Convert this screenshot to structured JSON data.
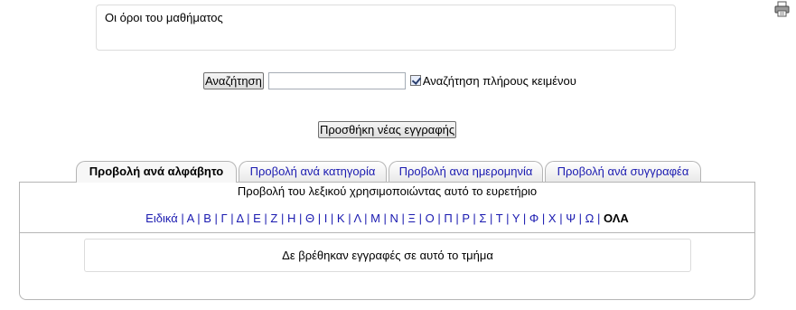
{
  "description": {
    "text": "Οι όροι του μαθήματος"
  },
  "search": {
    "button_label": "Αναζήτηση",
    "input_value": "",
    "fulltext_label": "Αναζήτηση πλήρους κειμένου",
    "fulltext_checked": true
  },
  "add_entry": {
    "label": "Προσθήκη νέας εγγραφής"
  },
  "icons": {
    "print": "printer-icon"
  },
  "tabs": [
    {
      "label": "Προβολή ανά αλφάβητο",
      "active": true
    },
    {
      "label": "Προβολή ανά κατηγορία",
      "active": false
    },
    {
      "label": "Προβολή ανα ημερομηνία",
      "active": false
    },
    {
      "label": "Προβολή ανά συγγραφέα",
      "active": false
    }
  ],
  "panel": {
    "caption": "Προβολή του λεξικού χρησιμοποιώντας αυτό το ευρετήριο",
    "letters": [
      "Ειδικά",
      "Α",
      "Β",
      "Γ",
      "Δ",
      "Ε",
      "Ζ",
      "Η",
      "Θ",
      "Ι",
      "Κ",
      "Λ",
      "Μ",
      "Ν",
      "Ξ",
      "Ο",
      "Π",
      "Ρ",
      "Σ",
      "Τ",
      "Υ",
      "Φ",
      "Χ",
      "Ψ",
      "Ω"
    ],
    "all_label": "ΟΛΑ",
    "empty_message": "Δε βρέθηκαν εγγραφές σε αυτό το τμήμα"
  },
  "colors": {
    "link": "#1a1ab0",
    "border": "#b5b5b5"
  }
}
